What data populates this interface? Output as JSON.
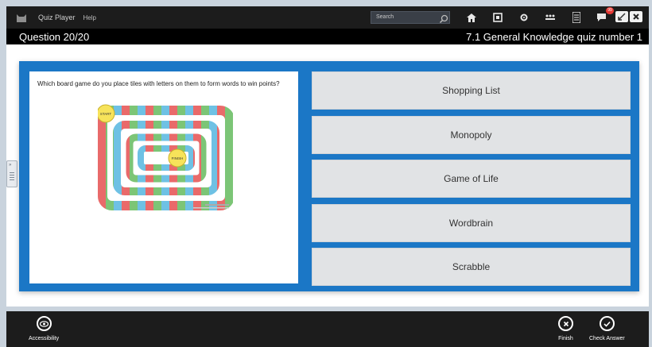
{
  "app": {
    "title": "Quiz Player",
    "help": "Help"
  },
  "search": {
    "placeholder": "Search"
  },
  "notifications": {
    "count": "99"
  },
  "subheader": {
    "question_counter": "Question 20/20",
    "quiz_title": "7.1 General Knowledge quiz number 1"
  },
  "question": {
    "text": "Which board game do you place tiles with letters on them to form words to win points?"
  },
  "board_image": {
    "start_label": "START",
    "finish_label": "FINISH"
  },
  "answers": [
    {
      "label": "Shopping List"
    },
    {
      "label": "Monopoly"
    },
    {
      "label": "Game of Life"
    },
    {
      "label": "Wordbrain"
    },
    {
      "label": "Scrabble"
    }
  ],
  "bottom": {
    "accessibility": "Accessibility",
    "finish": "Finish",
    "check_answer": "Check Answer"
  },
  "colors": {
    "accent": "#1b77c6",
    "topbar": "#1c1c1c",
    "answer_bg": "#e1e3e5"
  },
  "icons": [
    "cat-logo-icon",
    "search-icon",
    "home-icon",
    "bookmark-icon",
    "settings-icon",
    "people-icon",
    "list-icon",
    "chat-icon",
    "minimize-icon",
    "close-icon",
    "eye-icon",
    "x-circle-icon",
    "check-circle-icon"
  ]
}
